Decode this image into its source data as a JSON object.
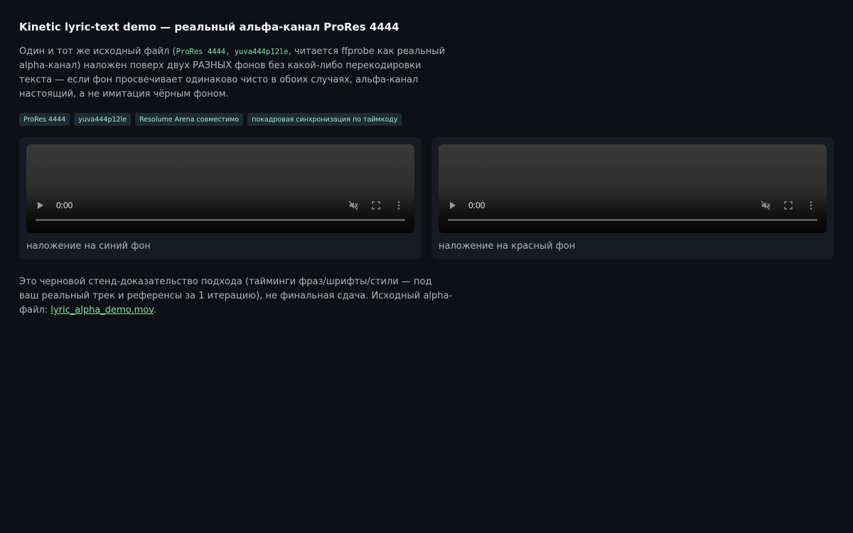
{
  "page": {
    "title": "Kinetic lyric-text demo — реальный альфа-канал ProRes 4444",
    "intro": {
      "before_code": "Один и тот же исходный файл (",
      "code": "ProRes 4444, yuva444p12le",
      "after_code": ", читается ffprobe как реальный alpha-канал) наложен поверх двух РАЗНЫХ фонов без какой-либо перекодировки текста — если фон просвечивает одинаково чисто в обоих случаях, альфа-канал настоящий, а не имитация чёрным фоном."
    },
    "tags": [
      "ProRes 4444",
      "yuva444p12le",
      "Resolume Arena совместимо",
      "покадровая синхронизация по таймкоду"
    ],
    "videos": [
      {
        "time": "0:00",
        "caption": "наложение на синий фон"
      },
      {
        "time": "0:00",
        "caption": "наложение на красный фон"
      }
    ],
    "footer": {
      "text": "Это черновой стенд-доказательство подхода (тайминги фраз/шрифты/стили — под ваш реальный трек и референсы за 1 итерацию), не финальная сдача. Исходный alpha-файл: ",
      "link_label": "lyric_alpha_demo.mov",
      "end": "."
    }
  },
  "icons": {
    "play": "play-icon",
    "mute": "volume-muted-icon",
    "fullscreen": "fullscreen-icon",
    "more": "more-vertical-icon"
  },
  "colors": {
    "background": "#0e1015",
    "card": "#161a22",
    "accent": "#7ee2a8",
    "tag_bg": "#1d2b36"
  }
}
